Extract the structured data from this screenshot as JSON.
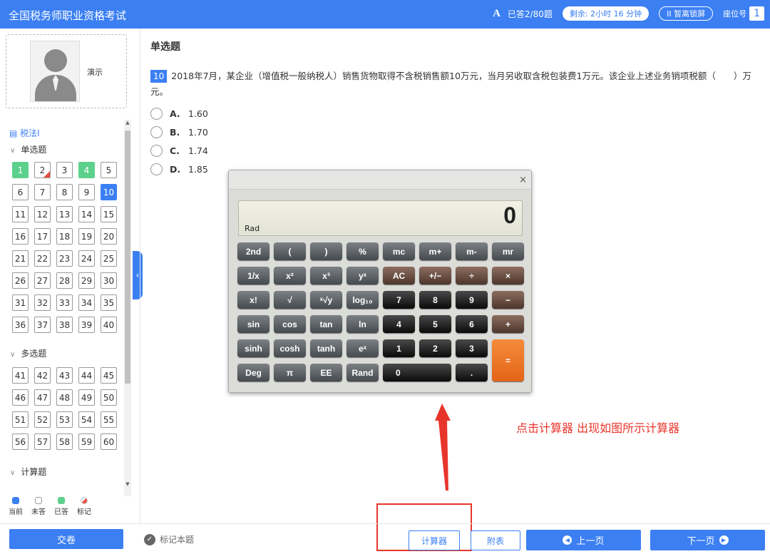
{
  "header": {
    "title": "全国税务师职业资格考试",
    "font_icon": "A",
    "answered": "已答2/80题",
    "timer": "剩余: 2小时 16 分钟",
    "lock_icon": "II",
    "lock": "暂离锁屏",
    "seat_label": "座位号",
    "seat_number": "1"
  },
  "sidebar": {
    "user_name": "演示",
    "subject": "税法I",
    "sections": [
      {
        "title": "单选题",
        "questions": [
          {
            "n": "1",
            "s": "done"
          },
          {
            "n": "2",
            "s": "marked"
          },
          {
            "n": "3",
            "s": ""
          },
          {
            "n": "4",
            "s": "done"
          },
          {
            "n": "5",
            "s": ""
          },
          {
            "n": "6",
            "s": ""
          },
          {
            "n": "7",
            "s": ""
          },
          {
            "n": "8",
            "s": ""
          },
          {
            "n": "9",
            "s": ""
          },
          {
            "n": "10",
            "s": "current"
          },
          {
            "n": "11",
            "s": ""
          },
          {
            "n": "12",
            "s": ""
          },
          {
            "n": "13",
            "s": ""
          },
          {
            "n": "14",
            "s": ""
          },
          {
            "n": "15",
            "s": ""
          },
          {
            "n": "16",
            "s": ""
          },
          {
            "n": "17",
            "s": ""
          },
          {
            "n": "18",
            "s": ""
          },
          {
            "n": "19",
            "s": ""
          },
          {
            "n": "20",
            "s": ""
          },
          {
            "n": "21",
            "s": ""
          },
          {
            "n": "22",
            "s": ""
          },
          {
            "n": "23",
            "s": ""
          },
          {
            "n": "24",
            "s": ""
          },
          {
            "n": "25",
            "s": ""
          },
          {
            "n": "26",
            "s": ""
          },
          {
            "n": "27",
            "s": ""
          },
          {
            "n": "28",
            "s": ""
          },
          {
            "n": "29",
            "s": ""
          },
          {
            "n": "30",
            "s": ""
          },
          {
            "n": "31",
            "s": ""
          },
          {
            "n": "32",
            "s": ""
          },
          {
            "n": "33",
            "s": ""
          },
          {
            "n": "34",
            "s": ""
          },
          {
            "n": "35",
            "s": ""
          },
          {
            "n": "36",
            "s": ""
          },
          {
            "n": "37",
            "s": ""
          },
          {
            "n": "38",
            "s": ""
          },
          {
            "n": "39",
            "s": ""
          },
          {
            "n": "40",
            "s": ""
          }
        ]
      },
      {
        "title": "多选题",
        "questions": [
          {
            "n": "41",
            "s": ""
          },
          {
            "n": "42",
            "s": ""
          },
          {
            "n": "43",
            "s": ""
          },
          {
            "n": "44",
            "s": ""
          },
          {
            "n": "45",
            "s": ""
          },
          {
            "n": "46",
            "s": ""
          },
          {
            "n": "47",
            "s": ""
          },
          {
            "n": "48",
            "s": ""
          },
          {
            "n": "49",
            "s": ""
          },
          {
            "n": "50",
            "s": ""
          },
          {
            "n": "51",
            "s": ""
          },
          {
            "n": "52",
            "s": ""
          },
          {
            "n": "53",
            "s": ""
          },
          {
            "n": "54",
            "s": ""
          },
          {
            "n": "55",
            "s": ""
          },
          {
            "n": "56",
            "s": ""
          },
          {
            "n": "57",
            "s": ""
          },
          {
            "n": "58",
            "s": ""
          },
          {
            "n": "59",
            "s": ""
          },
          {
            "n": "60",
            "s": ""
          }
        ]
      },
      {
        "title": "计算题",
        "questions": []
      }
    ],
    "legend": [
      {
        "label": "当前",
        "color": "#3b7ff2"
      },
      {
        "label": "未答",
        "color": "#ffffff"
      },
      {
        "label": "已答",
        "color": "#5cd18c"
      },
      {
        "label": "标记",
        "color": "#e84c3d"
      }
    ]
  },
  "question": {
    "type": "单选题",
    "number": "10",
    "text": "2018年7月，某企业（增值税一般纳税人）销售货物取得不含税销售额10万元，当月另收取含税包装费1万元。该企业上述业务销项税额（　　）万元。",
    "options": [
      {
        "key": "A.",
        "value": "1.60"
      },
      {
        "key": "B.",
        "value": "1.70"
      },
      {
        "key": "C.",
        "value": "1.74"
      },
      {
        "key": "D.",
        "value": "1.85"
      }
    ]
  },
  "calculator": {
    "close": "×",
    "display": "0",
    "mode": "Rad",
    "keys": [
      {
        "l": "2nd",
        "t": "fn"
      },
      {
        "l": "(",
        "t": "fn"
      },
      {
        "l": ")",
        "t": "fn"
      },
      {
        "l": "%",
        "t": "fn"
      },
      {
        "l": "mc",
        "t": "fn"
      },
      {
        "l": "m+",
        "t": "fn"
      },
      {
        "l": "m-",
        "t": "fn"
      },
      {
        "l": "mr",
        "t": "fn"
      },
      {
        "l": "1/x",
        "t": "fn"
      },
      {
        "l": "x²",
        "t": "fn"
      },
      {
        "l": "x³",
        "t": "fn"
      },
      {
        "l": "yˣ",
        "t": "fn"
      },
      {
        "l": "AC",
        "t": "op"
      },
      {
        "l": "+/−",
        "t": "op"
      },
      {
        "l": "÷",
        "t": "op"
      },
      {
        "l": "×",
        "t": "op"
      },
      {
        "l": "x!",
        "t": "fn"
      },
      {
        "l": "√",
        "t": "fn"
      },
      {
        "l": "ˣ√y",
        "t": "fn"
      },
      {
        "l": "log₁₀",
        "t": "fn"
      },
      {
        "l": "7",
        "t": "num"
      },
      {
        "l": "8",
        "t": "num"
      },
      {
        "l": "9",
        "t": "num"
      },
      {
        "l": "−",
        "t": "op"
      },
      {
        "l": "sin",
        "t": "fn"
      },
      {
        "l": "cos",
        "t": "fn"
      },
      {
        "l": "tan",
        "t": "fn"
      },
      {
        "l": "ln",
        "t": "fn"
      },
      {
        "l": "4",
        "t": "num"
      },
      {
        "l": "5",
        "t": "num"
      },
      {
        "l": "6",
        "t": "num"
      },
      {
        "l": "+",
        "t": "op"
      },
      {
        "l": "sinh",
        "t": "fn"
      },
      {
        "l": "cosh",
        "t": "fn"
      },
      {
        "l": "tanh",
        "t": "fn"
      },
      {
        "l": "eˣ",
        "t": "fn"
      },
      {
        "l": "1",
        "t": "num"
      },
      {
        "l": "2",
        "t": "num"
      },
      {
        "l": "3",
        "t": "num"
      },
      {
        "l": "=",
        "t": "eq"
      },
      {
        "l": "Deg",
        "t": "fn"
      },
      {
        "l": "π",
        "t": "fn"
      },
      {
        "l": "EE",
        "t": "fn"
      },
      {
        "l": "Rand",
        "t": "fn"
      },
      {
        "l": "0",
        "t": "zero"
      },
      {
        "l": ".",
        "t": "num"
      }
    ]
  },
  "annotation": {
    "text": "点击计算器 出现如图所示计算器"
  },
  "footer": {
    "submit": "交卷",
    "mark": "标记本题",
    "mark_icon": "✓",
    "calculator": "计算器",
    "table": "附表",
    "prev": "上一页",
    "prev_icon": "◀",
    "next": "下一页",
    "next_icon": "▶"
  },
  "colors": {
    "primary": "#3b7ff2",
    "done": "#5cd18c",
    "marked": "#e84c3d",
    "annotation": "#e8352b"
  }
}
